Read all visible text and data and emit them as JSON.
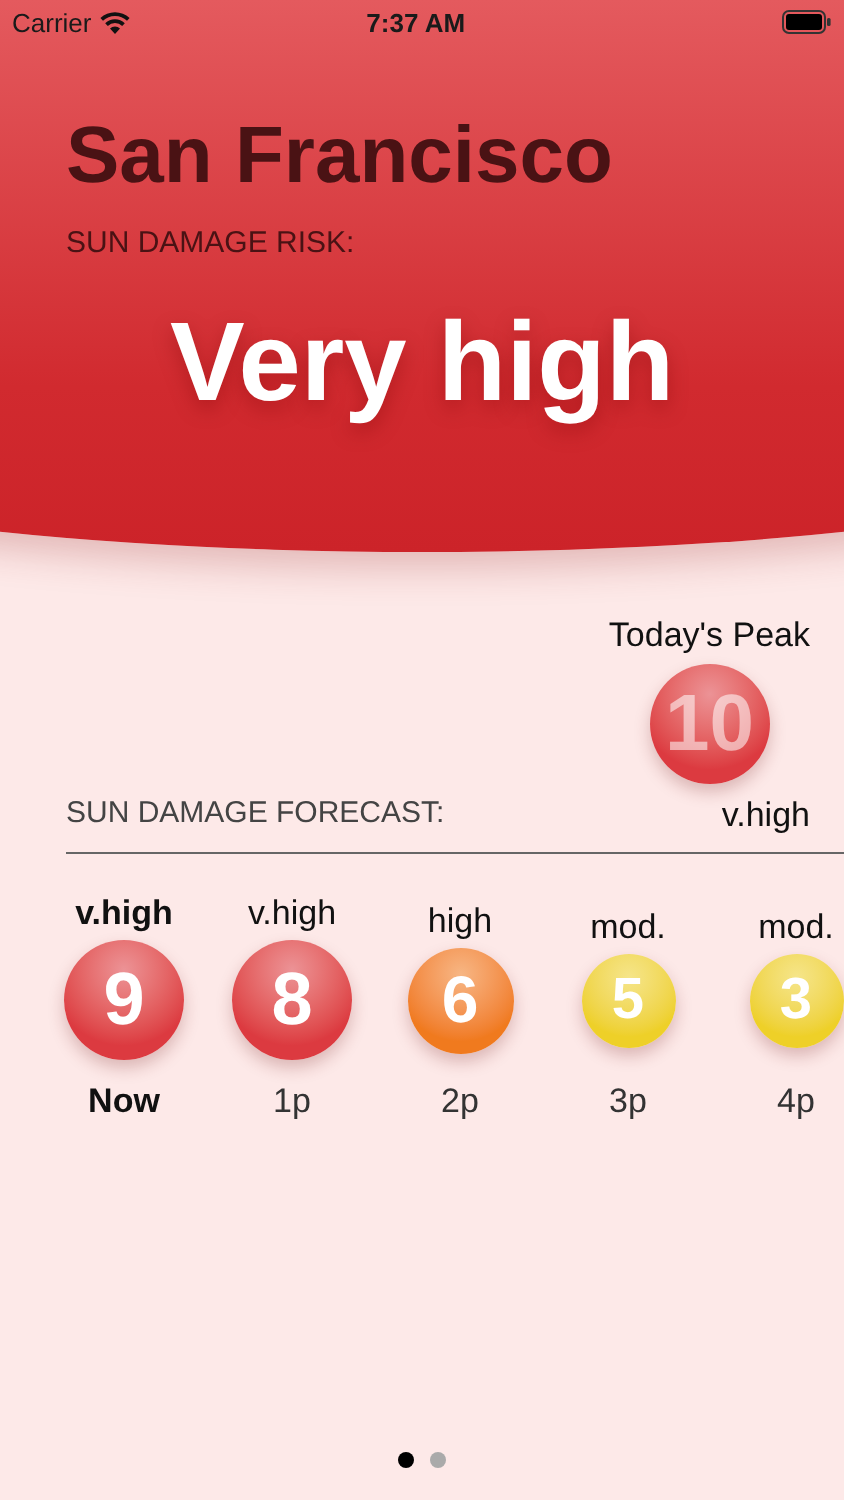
{
  "status_bar": {
    "carrier": "Carrier",
    "time": "7:37 AM"
  },
  "header": {
    "city": "San Francisco",
    "risk_label": "SUN DAMAGE RISK:",
    "risk": "Very high"
  },
  "peak": {
    "title": "Today's Peak",
    "value": "10",
    "rating": "v.high",
    "color": "#dc3a40",
    "kind": "large"
  },
  "forecast": {
    "title": "SUN DAMAGE FORECAST:",
    "hours": [
      {
        "rating": "v.high",
        "value": "9",
        "time": "Now",
        "selected": true,
        "color": "#dc3a40",
        "kind": "large"
      },
      {
        "rating": "v.high",
        "value": "8",
        "time": "1p",
        "selected": false,
        "color": "#dc3a40",
        "kind": "large"
      },
      {
        "rating": "high",
        "value": "6",
        "time": "2p",
        "selected": false,
        "color": "#f07a1e",
        "kind": "medium"
      },
      {
        "rating": "mod.",
        "value": "5",
        "time": "3p",
        "selected": false,
        "color": "#eed028",
        "kind": "small"
      },
      {
        "rating": "mod.",
        "value": "3",
        "time": "4p",
        "selected": false,
        "color": "#eed028",
        "kind": "small"
      }
    ]
  },
  "pages": [
    {
      "selected": true
    },
    {
      "selected": false
    }
  ]
}
